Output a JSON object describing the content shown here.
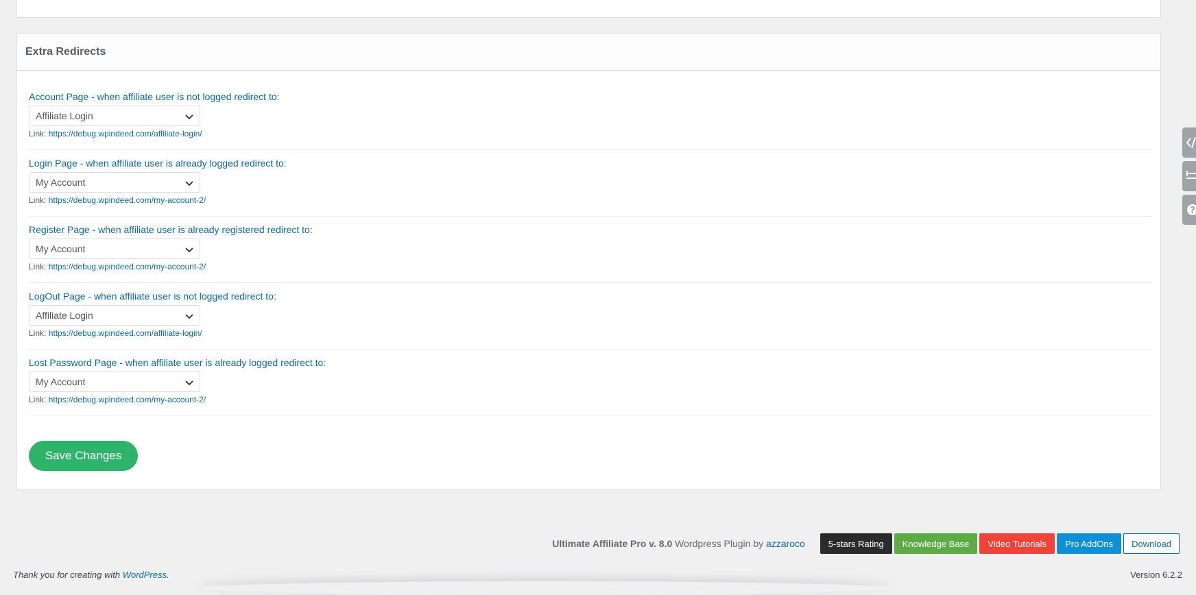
{
  "section": {
    "title": "Extra Redirects"
  },
  "redirects": [
    {
      "label": "Account Page - when affiliate user is not logged redirect to:",
      "selected": "Affiliate Login",
      "link_prefix": "Link:",
      "link": "https://debug.wpindeed.com/affiliate-login/"
    },
    {
      "label": "Login Page - when affiliate user is already logged redirect to:",
      "selected": "My Account",
      "link_prefix": "Link:",
      "link": "https://debug.wpindeed.com/my-account-2/"
    },
    {
      "label": "Register Page - when affiliate user is already registered redirect to:",
      "selected": "My Account",
      "link_prefix": "Link:",
      "link": "https://debug.wpindeed.com/my-account-2/"
    },
    {
      "label": "LogOut Page - when affiliate user is not logged redirect to:",
      "selected": "Affiliate Login",
      "link_prefix": "Link:",
      "link": "https://debug.wpindeed.com/affiliate-login/"
    },
    {
      "label": "Lost Password Page - when affiliate user is already logged redirect to:",
      "selected": "My Account",
      "link_prefix": "Link:",
      "link": "https://debug.wpindeed.com/my-account-2/"
    }
  ],
  "save_label": "Save Changes",
  "side_tabs": [
    "code-icon",
    "arrows-icon",
    "help-icon"
  ],
  "footer": {
    "plugin_name": "Ultimate Affiliate Pro v. 8.0",
    "plugin_middle": "Wordpress Plugin by",
    "plugin_author": "azzaroco",
    "buttons": [
      {
        "label": "5-stars Rating",
        "color": "#2b2b2b"
      },
      {
        "label": "Knowledge Base",
        "color": "#5cab44"
      },
      {
        "label": "Video Tutorials",
        "color": "#f0433a"
      },
      {
        "label": "Pro AddOns",
        "color": "#0e90d6"
      },
      {
        "label": "Download",
        "color": "#ffffff"
      }
    ],
    "thanks_text": "Thank you for creating with",
    "thanks_link": "WordPress",
    "thanks_end": ".",
    "version": "Version 6.2.2"
  },
  "colors": {
    "accent_green": "#2eb46a",
    "link_blue": "#0b6aa2"
  }
}
